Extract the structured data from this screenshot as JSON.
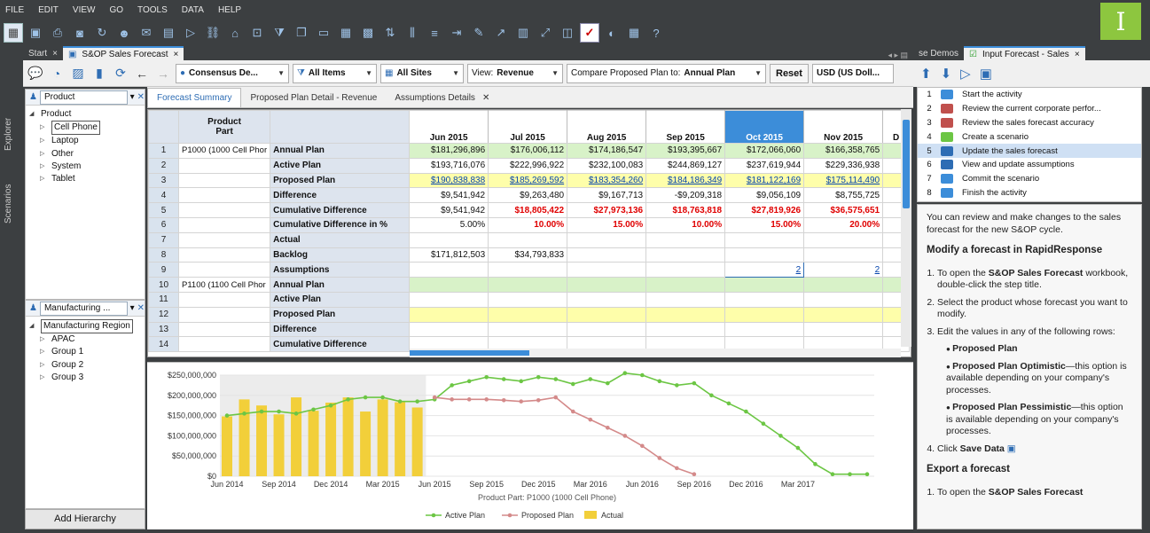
{
  "menu": [
    "FILE",
    "EDIT",
    "VIEW",
    "GO",
    "TOOLS",
    "DATA",
    "HELP"
  ],
  "logo_letter": "I",
  "leftstrip": {
    "explorer": "Explorer",
    "scenarios": "Scenarios"
  },
  "tabs": {
    "start": "Start",
    "sop": "S&OP Sales Forecast",
    "demos": "se Demos",
    "input": "Input Forecast - Sales"
  },
  "viewbar": {
    "scenario": "Consensus De...",
    "filter": "All Items",
    "sites": "All Sites",
    "view_label": "View:",
    "view_value": "Revenue",
    "compare_label": "Compare Proposed Plan to:",
    "compare_value": "Annual Plan",
    "reset": "Reset",
    "currency": "USD (US Doll..."
  },
  "explorer": {
    "product_combo": "Product",
    "product_tree": {
      "root": "Product",
      "children": [
        "Cell Phone",
        "Laptop",
        "Other",
        "System",
        "Tablet"
      ]
    },
    "mfg_combo": "Manufacturing ...",
    "mfg_tree": {
      "root": "Manufacturing Region",
      "children": [
        "APAC",
        "Group 1",
        "Group 2",
        "Group 3"
      ]
    },
    "add_hierarchy": "Add Hierarchy"
  },
  "inner_tabs": [
    "Forecast Summary",
    "Proposed Plan Detail - Revenue",
    "Assumptions Details"
  ],
  "grid": {
    "header_product": "Product",
    "header_part": "Part",
    "months": [
      "Jun 2015",
      "Jul 2015",
      "Aug 2015",
      "Sep 2015",
      "Oct 2015",
      "Nov 2015",
      "D"
    ],
    "rows": [
      {
        "n": "1",
        "part": "P1000 (1000 Cell Phor",
        "label": "Annual Plan",
        "cls": "g",
        "vals": [
          "$181,296,896",
          "$176,006,112",
          "$174,186,547",
          "$193,395,667",
          "$172,066,060",
          "$166,358,765",
          ""
        ]
      },
      {
        "n": "2",
        "part": "",
        "label": "Active Plan",
        "cls": "",
        "vals": [
          "$193,716,076",
          "$222,996,922",
          "$232,100,083",
          "$244,869,127",
          "$237,619,944",
          "$229,336,938",
          ""
        ]
      },
      {
        "n": "3",
        "part": "",
        "label": "Proposed Plan",
        "cls": "y",
        "vals": [
          "$190,838,838",
          "$185,269,592",
          "$183,354,260",
          "$184,186,349",
          "$181,122,169",
          "$175,114,490",
          ""
        ]
      },
      {
        "n": "4",
        "part": "",
        "label": "Difference",
        "cls": "",
        "vals": [
          "$9,541,942",
          "$9,263,480",
          "$9,167,713",
          "-$9,209,318",
          "$9,056,109",
          "$8,755,725",
          ""
        ]
      },
      {
        "n": "5",
        "part": "",
        "label": "Cumulative Difference",
        "cls": "",
        "vals": [
          "$9,541,942",
          "$18,805,422",
          "$27,973,136",
          "$18,763,818",
          "$27,819,926",
          "$36,575,651",
          ""
        ]
      },
      {
        "n": "6",
        "part": "",
        "label": "Cumulative Difference in %",
        "cls": "",
        "vals": [
          "5.00%",
          "10.00%",
          "15.00%",
          "10.00%",
          "15.00%",
          "20.00%",
          ""
        ]
      },
      {
        "n": "7",
        "part": "",
        "label": "Actual",
        "cls": "",
        "vals": [
          "",
          "",
          "",
          "",
          "",
          "",
          ""
        ]
      },
      {
        "n": "8",
        "part": "",
        "label": "Backlog",
        "cls": "",
        "vals": [
          "$171,812,503",
          "$34,793,833",
          "",
          "",
          "",
          "",
          ""
        ]
      },
      {
        "n": "9",
        "part": "",
        "label": "Assumptions",
        "cls": "",
        "vals": [
          "",
          "",
          "",
          "",
          "2",
          "2",
          ""
        ]
      },
      {
        "n": "10",
        "part": "P1100 (1100 Cell Phor",
        "label": "Annual Plan",
        "cls": "g",
        "vals": [
          "",
          "",
          "",
          "",
          "",
          "",
          ""
        ]
      },
      {
        "n": "11",
        "part": "",
        "label": "Active Plan",
        "cls": "",
        "vals": [
          "",
          "",
          "",
          "",
          "",
          "",
          ""
        ]
      },
      {
        "n": "12",
        "part": "",
        "label": "Proposed Plan",
        "cls": "y",
        "vals": [
          "",
          "",
          "",
          "",
          "",
          "",
          ""
        ]
      },
      {
        "n": "13",
        "part": "",
        "label": "Difference",
        "cls": "",
        "vals": [
          "",
          "",
          "",
          "",
          "",
          "",
          ""
        ]
      },
      {
        "n": "14",
        "part": "",
        "label": "Cumulative Difference",
        "cls": "",
        "vals": [
          "",
          "",
          "",
          "",
          "",
          "",
          ""
        ]
      }
    ]
  },
  "chart_data": {
    "type": "line",
    "xlabel": "Product Part: P1000 (1000 Cell Phone)",
    "ylim": [
      0,
      250000000
    ],
    "yticks": [
      "$0",
      "$50,000,000",
      "$100,000,000",
      "$150,000,000",
      "$200,000,000",
      "$250,000,000"
    ],
    "xticks": [
      "Jun 2014",
      "Sep 2014",
      "Dec 2014",
      "Mar 2015",
      "Jun 2015",
      "Sep 2015",
      "Dec 2015",
      "Mar 2016",
      "Jun 2016",
      "Sep 2016",
      "Dec 2016",
      "Mar 2017"
    ],
    "months_count": 35,
    "series": [
      {
        "name": "Active Plan",
        "color": "#6cc644",
        "start": 0,
        "values": [
          150,
          155,
          160,
          160,
          155,
          165,
          175,
          190,
          195,
          195,
          185,
          185,
          190,
          225,
          235,
          245,
          240,
          235,
          245,
          240,
          228,
          240,
          230,
          255,
          250,
          235,
          225,
          230,
          200,
          180,
          160,
          130,
          100,
          70,
          30,
          5,
          5,
          5
        ]
      },
      {
        "name": "Proposed Plan",
        "color": "#d48a8a",
        "start": 12,
        "values": [
          195,
          190,
          190,
          190,
          188,
          185,
          188,
          195,
          160,
          140,
          120,
          100,
          75,
          45,
          20,
          5
        ]
      },
      {
        "name": "Actual",
        "color": "#f2cf3a",
        "type": "bar",
        "start": 0,
        "values": [
          148,
          190,
          175,
          153,
          195,
          162,
          182,
          195,
          160,
          190,
          183,
          170
        ]
      }
    ],
    "legend": [
      "Active Plan",
      "Proposed Plan",
      "Actual"
    ]
  },
  "steps": [
    {
      "n": "1",
      "label": "Start the activity",
      "color": "#3c8dd9"
    },
    {
      "n": "2",
      "label": "Review the current corporate perfor...",
      "color": "#c0504d"
    },
    {
      "n": "3",
      "label": "Review the sales forecast accuracy",
      "color": "#c0504d"
    },
    {
      "n": "4",
      "label": "Create a scenario",
      "color": "#6cc644"
    },
    {
      "n": "5",
      "label": "Update the sales forecast",
      "color": "#2e6db4"
    },
    {
      "n": "6",
      "label": "View and update assumptions",
      "color": "#2e6db4"
    },
    {
      "n": "7",
      "label": "Commit the scenario",
      "color": "#3c8dd9"
    },
    {
      "n": "8",
      "label": "Finish the activity",
      "color": "#3c8dd9"
    }
  ],
  "help": {
    "intro": "You can review and make changes to the sales forecast for the new S&OP cycle.",
    "h1": "Modify a forecast in RapidResponse",
    "li1_a": "To open the ",
    "li1_b": "S&OP Sales Forecast",
    "li1_c": " workbook, double-click the step title.",
    "li2": "Select the product whose forecast you want to modify.",
    "li3": "Edit the values in any of the following rows:",
    "bul1": "Proposed Plan",
    "bul2_a": "Proposed Plan Optimistic",
    "bul2_b": "—this option is available depending on your company's processes.",
    "bul3_a": "Proposed Plan Pessimistic",
    "bul3_b": "—this option is available depending on your company's processes.",
    "li4_a": "Click ",
    "li4_b": "Save Data",
    "h2": "Export a forecast",
    "li5_a": "To open the ",
    "li5_b": "S&OP Sales Forecast"
  }
}
